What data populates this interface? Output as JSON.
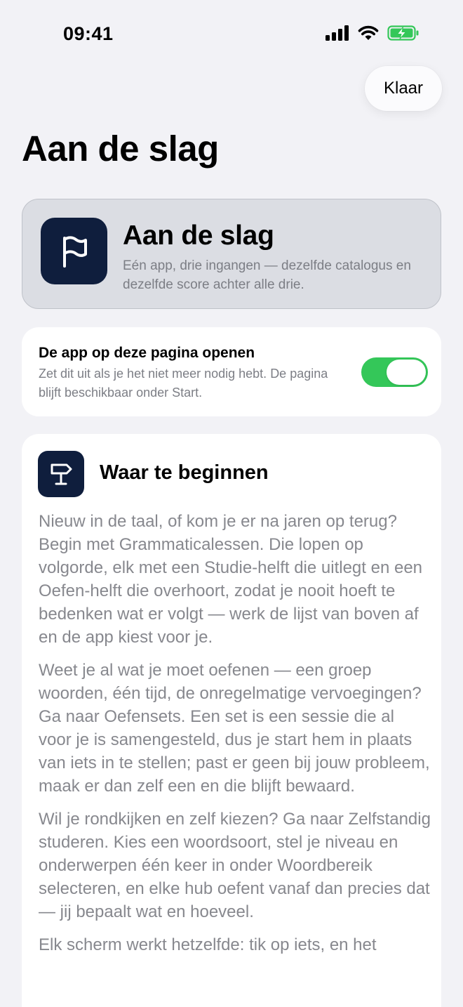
{
  "status_bar": {
    "time": "09:41",
    "icons": [
      "cellular-signal-icon",
      "wifi-icon",
      "battery-charging-icon"
    ],
    "battery_color": "#34C759"
  },
  "header": {
    "done_label": "Klaar",
    "title": "Aan de slag"
  },
  "hero": {
    "icon": "flag-icon",
    "title": "Aan de slag",
    "subtitle": "Eén app, drie ingangen — dezelfde catalogus en dezelfde score achter alle drie."
  },
  "setting": {
    "title": "De app op deze pagina openen",
    "description": "Zet dit uit als je het niet meer nodig hebt. De pagina blijft beschikbaar onder Start.",
    "enabled": true,
    "accent": "#34C759"
  },
  "section": {
    "icon": "signpost-icon",
    "title": "Waar te beginnen",
    "paragraphs": [
      "Nieuw in de taal, of kom je er na jaren op terug? Begin met Grammaticalessen. Die lopen op volgorde, elk met een Studie-helft die uitlegt en een Oefen-helft die overhoort, zodat je nooit hoeft te bedenken wat er volgt — werk de lijst van boven af en de app kiest voor je.",
      "Weet je al wat je moet oefenen — een groep woorden, één tijd, de onregelmatige vervoegingen? Ga naar Oefensets. Een set is een sessie die al voor je is samengesteld, dus je start hem in plaats van iets in te stellen; past er geen bij jouw probleem, maak er dan zelf een en die blijft bewaard.",
      "Wil je rondkijken en zelf kiezen? Ga naar Zelfstandig studeren. Kies een woordsoort, stel je niveau en onderwerpen één keer in onder Woordbereik selecteren, en elke hub oefent vanaf dan precies dat — jij bepaalt wat en hoeveel.",
      "Elk scherm werkt hetzelfde: tik op iets, en het"
    ]
  },
  "colors": {
    "background": "#F2F2F6",
    "icon_tile": "#0F1E3D",
    "hero_card": "#DBDDE3",
    "secondary_text": "#7C7E85"
  }
}
